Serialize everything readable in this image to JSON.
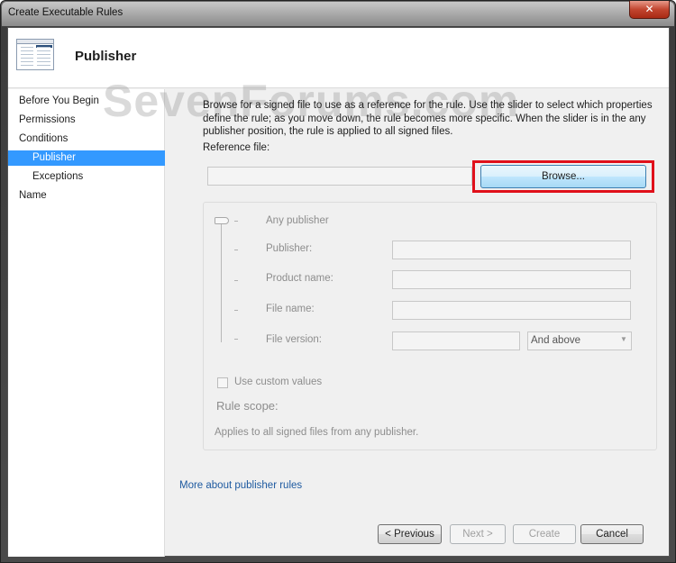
{
  "window": {
    "title": "Create Executable Rules",
    "close_icon": "close-icon"
  },
  "header": {
    "title": "Publisher",
    "icon": "rule-wizard-icon"
  },
  "watermark": "SevenForums.com",
  "nav": {
    "items": [
      {
        "label": "Before You Begin",
        "selected": false
      },
      {
        "label": "Permissions",
        "selected": false
      },
      {
        "label": "Conditions",
        "selected": false
      },
      {
        "label": "Publisher",
        "selected": true
      },
      {
        "label": "Exceptions",
        "selected": false
      },
      {
        "label": "Name",
        "selected": false
      }
    ]
  },
  "main": {
    "description": "Browse for a signed file to use as a reference for the rule. Use the slider to select which properties define the rule; as you move down, the rule becomes more specific. When the slider is in the any publisher position, the rule is applied to all signed files.",
    "reference_label": "Reference file:",
    "reference_value": "",
    "browse_label": "Browse...",
    "highlight_color": "#e0101a",
    "slider": {
      "levels": [
        "Any publisher",
        "Publisher:",
        "Product name:",
        "File name:",
        "File version:"
      ],
      "selected_index": 0
    },
    "fields": {
      "publisher": "",
      "product_name": "",
      "file_name": "",
      "file_version": "",
      "version_option": "And above"
    },
    "custom_values_label": "Use custom values",
    "custom_values_checked": false,
    "rule_scope_label": "Rule scope:",
    "rule_scope_text": "Applies to all signed files from any publisher.",
    "link": "More about publisher rules"
  },
  "footer": {
    "previous": "< Previous",
    "next": "Next >",
    "create": "Create",
    "cancel": "Cancel"
  },
  "colors": {
    "selected_nav": "#3399ff",
    "link": "#1e5aa0"
  }
}
